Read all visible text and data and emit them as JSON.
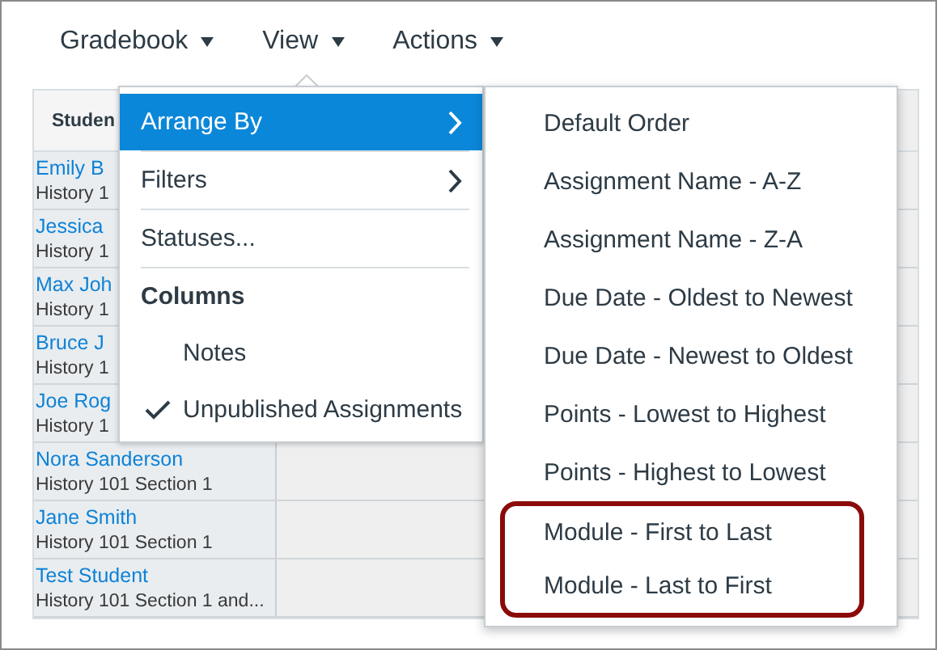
{
  "menubar": [
    {
      "label": "Gradebook"
    },
    {
      "label": "View",
      "open": true
    },
    {
      "label": "Actions"
    }
  ],
  "table": {
    "columns": [
      "Studen"
    ],
    "rows": [
      {
        "name": "Emily B",
        "section": "History 1"
      },
      {
        "name": "Jessica",
        "section": "History 1"
      },
      {
        "name": "Max Joh",
        "section": "History 1"
      },
      {
        "name": "Bruce J",
        "section": "History 1"
      },
      {
        "name": "Joe Rog",
        "section": "History 1"
      },
      {
        "name": "Nora Sanderson",
        "section": "History 101 Section 1"
      },
      {
        "name": "Jane Smith",
        "section": "History 101 Section 1"
      },
      {
        "name": "Test Student",
        "section": "History 101 Section 1 and..."
      }
    ]
  },
  "view_menu": {
    "items": [
      {
        "kind": "submenu",
        "label": "Arrange By",
        "selected": true
      },
      {
        "kind": "submenu",
        "label": "Filters",
        "selected": false
      },
      {
        "kind": "action",
        "label": "Statuses..."
      },
      {
        "kind": "heading",
        "label": "Columns"
      },
      {
        "kind": "toggle",
        "label": "Notes",
        "checked": false
      },
      {
        "kind": "toggle",
        "label": "Unpublished Assignments",
        "checked": true
      }
    ]
  },
  "arrange_menu": {
    "items": [
      {
        "label": "Default Order",
        "outlined": false
      },
      {
        "label": "Assignment Name - A-Z",
        "outlined": false
      },
      {
        "label": "Assignment Name - Z-A",
        "outlined": false
      },
      {
        "label": "Due Date - Oldest to Newest",
        "outlined": false
      },
      {
        "label": "Due Date - Newest to Oldest",
        "outlined": false
      },
      {
        "label": "Points - Lowest to Highest",
        "outlined": false
      },
      {
        "label": "Points - Highest to Lowest",
        "outlined": false
      },
      {
        "label": "Module - First to Last",
        "outlined": true
      },
      {
        "label": "Module - Last to First",
        "outlined": true
      }
    ]
  }
}
